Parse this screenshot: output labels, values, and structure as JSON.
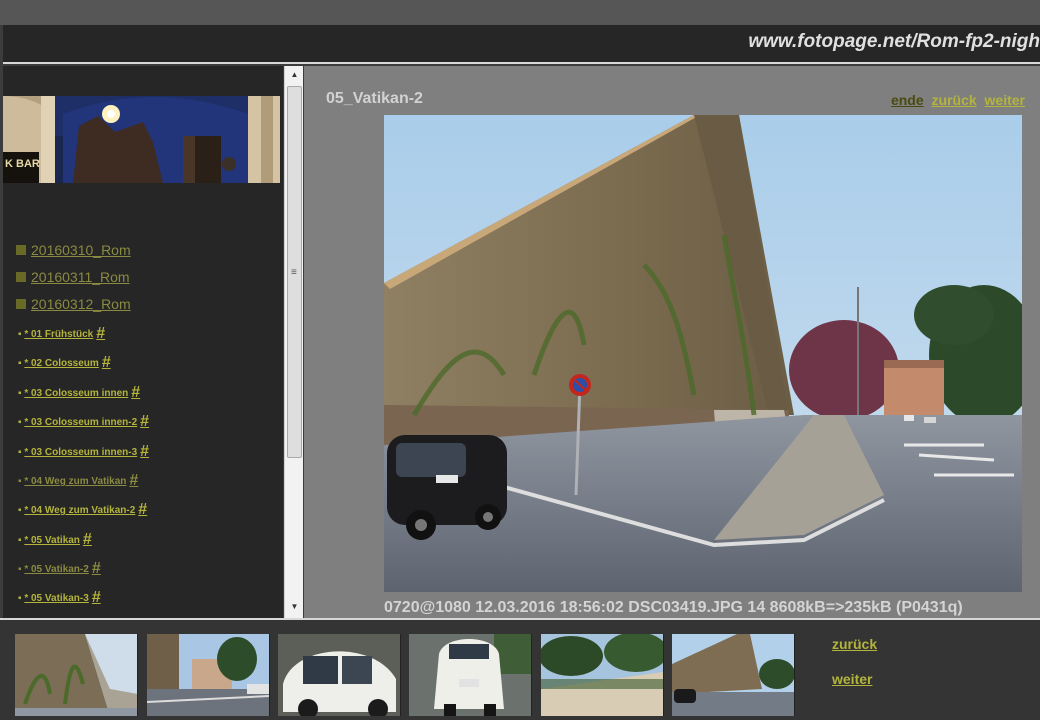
{
  "colors": {
    "link": "#b4b43c",
    "link_dim": "#8a8a42",
    "link_dark": "#4a4a10",
    "active": "#c0c060",
    "folder_square": "#6a6a28"
  },
  "header": {
    "site_title": "www.fotopage.net/Rom-fp2-nigh"
  },
  "sidebar": {
    "folders": [
      "20160310_Rom",
      "20160311_Rom",
      "20160312_Rom"
    ],
    "items": [
      {
        "label": "* 01  Frühstück",
        "hash": "#",
        "dim": false
      },
      {
        "label": "* 02  Colosseum",
        "hash": "#",
        "dim": false
      },
      {
        "label": "* 03  Colosseum  innen",
        "hash": "#",
        "dim": false
      },
      {
        "label": "* 03  Colosseum  innen-2",
        "hash": "#",
        "dim": false
      },
      {
        "label": "* 03  Colosseum  innen-3",
        "hash": "#",
        "dim": false
      },
      {
        "label": "* 04  Weg  zum  Vatikan",
        "hash": "#",
        "dim": true
      },
      {
        "label": "* 04  Weg  zum  Vatikan-2",
        "hash": "#",
        "dim": false
      },
      {
        "label": "* 05  Vatikan",
        "hash": "#",
        "dim": false
      },
      {
        "label": "* 05  Vatikan-2",
        "hash": "#",
        "dim": true
      },
      {
        "label": "* 05  Vatikan-3",
        "hash": "#",
        "dim": false
      }
    ]
  },
  "main": {
    "title": "05_Vatikan-2",
    "nav": {
      "ende": "ende",
      "zurueck": "zurück",
      "weiter": "weiter"
    },
    "caption": "0720@1080 12.03.2016 18:56:02 DSC03419.JPG 14 8608kB=>235kB (P0431q)"
  },
  "bottom": {
    "zurueck": "zurück",
    "weiter": "weiter"
  }
}
